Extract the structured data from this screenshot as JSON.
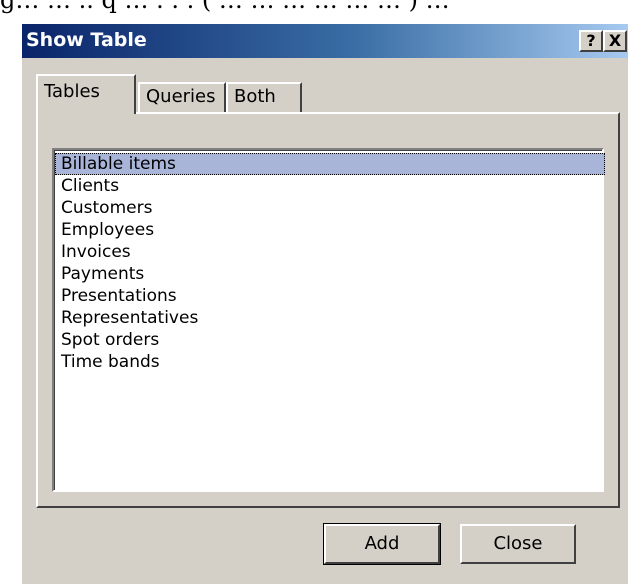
{
  "page_top_fragment": "g… … .. q … . . . ( … … …   … … … ) …",
  "window": {
    "title": "Show Table",
    "help_label": "?",
    "close_label": "X"
  },
  "tabs": [
    {
      "label": "Tables",
      "active": true
    },
    {
      "label": "Queries",
      "active": false
    },
    {
      "label": "Both",
      "active": false
    }
  ],
  "list": {
    "items": [
      {
        "label": "Billable items",
        "selected": true
      },
      {
        "label": "Clients"
      },
      {
        "label": "Customers"
      },
      {
        "label": "Employees"
      },
      {
        "label": "Invoices"
      },
      {
        "label": "Payments"
      },
      {
        "label": "Presentations"
      },
      {
        "label": "Representatives"
      },
      {
        "label": "Spot orders"
      },
      {
        "label": "Time bands"
      }
    ]
  },
  "buttons": {
    "add_label": "Add",
    "close_label": "Close"
  },
  "colors": {
    "titlebar_start": "#0a246a",
    "titlebar_end": "#a6caf0",
    "dialog_face": "#d4d0c8",
    "selection": "#a8b4d8"
  }
}
